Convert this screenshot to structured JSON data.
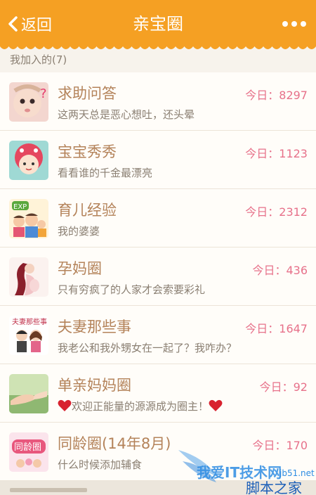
{
  "header": {
    "back_label": "返回",
    "title": "亲宝圈"
  },
  "section_label": "我加入的(7)",
  "groups": [
    {
      "name": "求助问答",
      "desc": "这两天总是恶心想吐，还头晕",
      "count": "今日：8297",
      "icon": "baby-face-icon"
    },
    {
      "name": "宝宝秀秀",
      "desc": "看看谁的千金最漂亮",
      "count": "今日：1123",
      "icon": "cartoon-girl-icon"
    },
    {
      "name": "育儿经验",
      "desc": "我的婆婆",
      "count": "今日：2312",
      "icon": "family-exp-icon"
    },
    {
      "name": "孕妈圈",
      "desc": "只有穷疯了的人家才会索要彩礼",
      "count": "今日：436",
      "icon": "pregnant-mom-icon"
    },
    {
      "name": "夫妻那些事",
      "desc": "我老公和我外甥女在一起了？我咋办？",
      "count": "今日：1647",
      "icon": "couple-icon"
    },
    {
      "name": "单亲妈妈圈",
      "desc": "欢迎正能量的源源成为圈主！",
      "count": "今日：92",
      "icon": "holding-hands-icon"
    },
    {
      "name": "同龄圈(14年8月)",
      "desc": "什么时候添加辅食",
      "count": "今日：170",
      "icon": "same-age-icon"
    }
  ],
  "watermark": {
    "line1": "我爱IT技术网",
    "line2": "jb51.net",
    "line3": "脚本之家"
  },
  "colors": {
    "header": "#f5a023",
    "accent_name": "#b4835a",
    "count": "#e7718a"
  }
}
